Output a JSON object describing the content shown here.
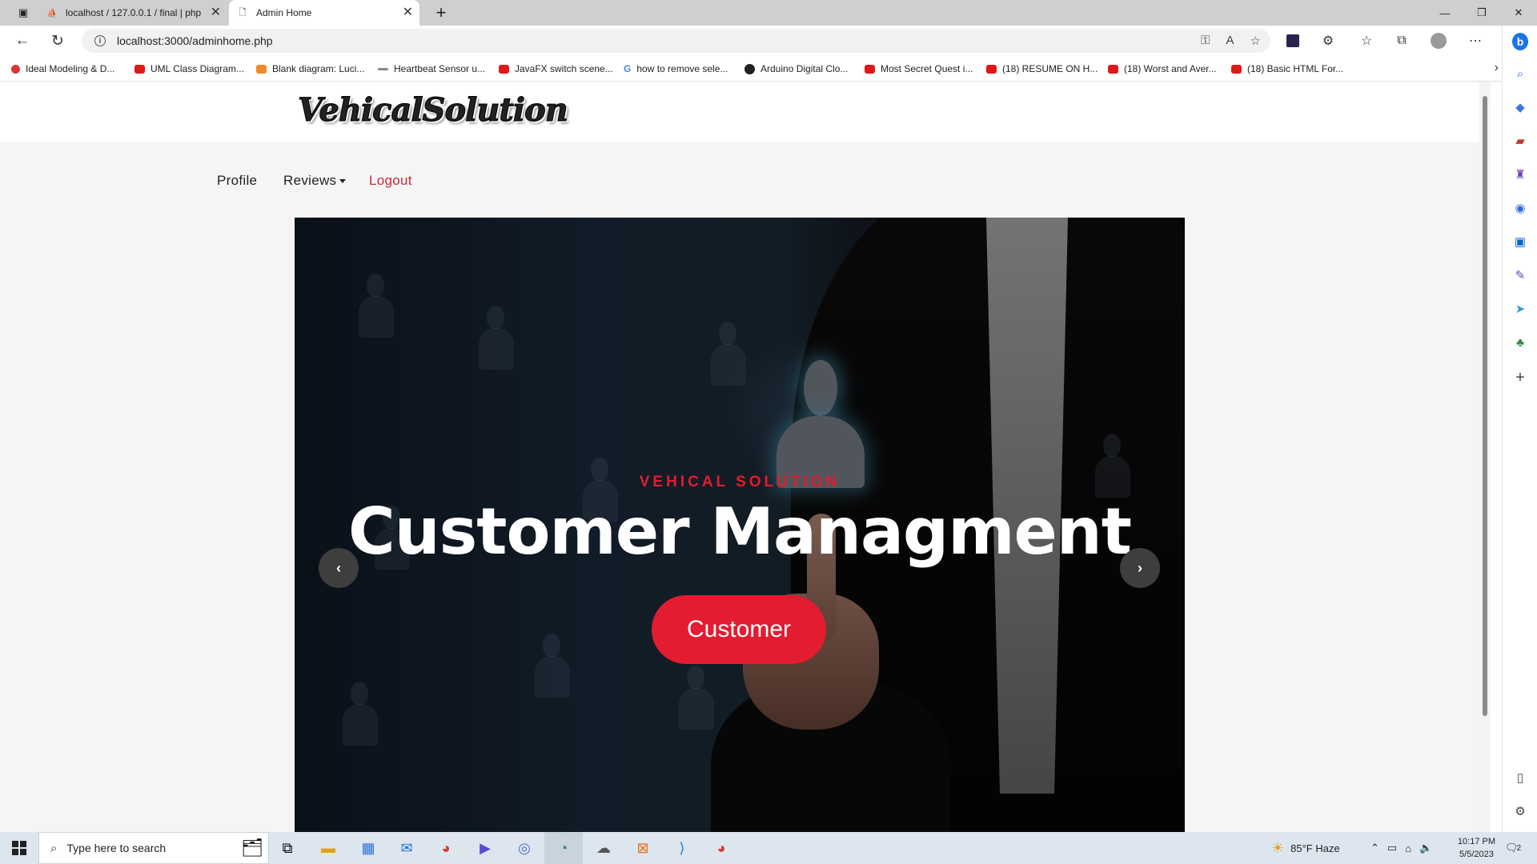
{
  "browser": {
    "tabs": [
      {
        "title": "localhost / 127.0.0.1 / final | php",
        "active": false
      },
      {
        "title": "Admin Home",
        "active": true
      }
    ],
    "url": "localhost:3000/adminhome.php",
    "bookmarks": [
      "Ideal Modeling & D...",
      "UML Class Diagram...",
      "Blank diagram: Luci...",
      "Heartbeat Sensor u...",
      "JavaFX switch scene...",
      "how to remove sele...",
      "Arduino Digital Clo...",
      "Most Secret Quest i...",
      "(18) RESUME ON H...",
      "(18) Worst and Aver...",
      "(18) Basic HTML For..."
    ]
  },
  "site": {
    "logo": "VehicalSolution",
    "nav": {
      "profile": "Profile",
      "reviews": "Reviews",
      "logout": "Logout"
    },
    "hero": {
      "subtitle": "VEHICAL SOLUTION",
      "title": "Customer Managment",
      "button": "Customer",
      "prev_icon": "chevron-left-icon",
      "next_icon": "chevron-right-icon"
    }
  },
  "taskbar": {
    "search_placeholder": "Type here to search",
    "weather": "85°F  Haze",
    "time": "10:17 PM",
    "date": "5/5/2023",
    "notifications": "2"
  },
  "colors": {
    "accent": "#e31c30",
    "logout": "#cc2a33"
  }
}
